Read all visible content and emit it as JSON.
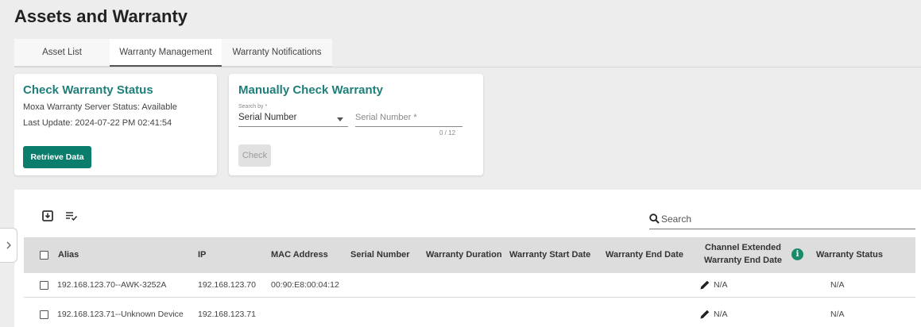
{
  "page": {
    "title": "Assets and Warranty"
  },
  "tabs": [
    {
      "label": "Asset List"
    },
    {
      "label": "Warranty Management"
    },
    {
      "label": "Warranty Notifications"
    }
  ],
  "status_card": {
    "title": "Check Warranty Status",
    "server_status": "Moxa Warranty Server Status: Available",
    "last_update": "Last Update: 2024-07-22 PM 02:41:54",
    "retrieve_button": "Retrieve Data"
  },
  "manual_card": {
    "title": "Manually Check Warranty",
    "search_by_label": "Search by *",
    "search_by_value": "Serial Number",
    "serial_placeholder": "Serial Number *",
    "char_counter": "0 / 12",
    "check_button": "Check"
  },
  "toolbar": {
    "export_icon": "export-icon",
    "column_icon": "column-settings-icon",
    "search_placeholder": "Search"
  },
  "table": {
    "columns": {
      "alias": "Alias",
      "ip": "IP",
      "mac": "MAC Address",
      "serial": "Serial Number",
      "duration": "Warranty Duration",
      "start": "Warranty Start Date",
      "end": "Warranty End Date",
      "channel_line1": "Channel Extended",
      "channel_line2": "Warranty End Date",
      "status": "Warranty Status"
    },
    "rows": [
      {
        "alias": "192.168.123.70--AWK-3252A",
        "ip": "192.168.123.70",
        "mac": "00:90:E8:00:04:12",
        "serial": "",
        "duration": "",
        "start": "",
        "end": "",
        "channel": "N/A",
        "status": "N/A"
      },
      {
        "alias": "192.168.123.71--Unknown Device",
        "ip": "192.168.123.71",
        "mac": "",
        "serial": "",
        "duration": "",
        "start": "",
        "end": "",
        "channel": "N/A",
        "status": "N/A"
      }
    ]
  },
  "colors": {
    "accent": "#1e7f7a",
    "primary_button": "#0b7d6c",
    "info": "#1b8a6b"
  }
}
